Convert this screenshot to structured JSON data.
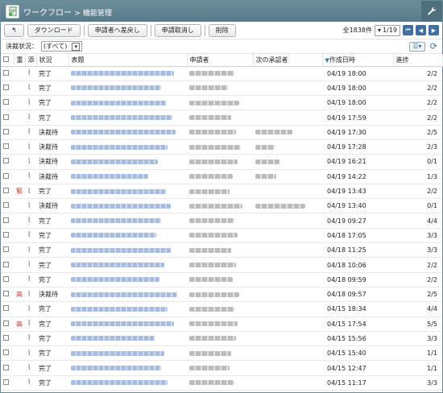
{
  "window": {
    "title": "ワークフロー",
    "separator": ">",
    "subtitle": "機能管理"
  },
  "toolbar": {
    "back_icon": "back-arrow-icon",
    "download_label": "ダウンロード",
    "return_label": "申請者へ差戻し",
    "cancel_label": "申請取消し",
    "delete_label": "削除",
    "total_label": "全1838件",
    "page_value": "1/19",
    "page_select_chevron": "▾"
  },
  "filter": {
    "label": "決裁状況：",
    "value": "(すべて)"
  },
  "table": {
    "headers": {
      "importance": "重",
      "attach": "添",
      "status": "状況",
      "subject": "表題",
      "applicant": "申請者",
      "next_approver": "次の承認者",
      "created": "作成日時",
      "progress": "進捗"
    },
    "rows": [
      {
        "priority": "",
        "status": "完了",
        "created": "04/19 18:00",
        "progress": "2/2",
        "has_next": false
      },
      {
        "priority": "",
        "status": "完了",
        "created": "04/19 18:00",
        "progress": "2/2",
        "has_next": false
      },
      {
        "priority": "",
        "status": "完了",
        "created": "04/19 18:00",
        "progress": "2/2",
        "has_next": false
      },
      {
        "priority": "",
        "status": "完了",
        "created": "04/19 17:59",
        "progress": "2/2",
        "has_next": false
      },
      {
        "priority": "",
        "status": "決裁待",
        "created": "04/19 17:30",
        "progress": "2/5",
        "has_next": true
      },
      {
        "priority": "",
        "status": "決裁待",
        "created": "04/19 17:28",
        "progress": "2/3",
        "has_next": true
      },
      {
        "priority": "",
        "status": "決裁待",
        "created": "04/19 16:21",
        "progress": "0/1",
        "has_next": true
      },
      {
        "priority": "",
        "status": "決裁待",
        "created": "04/19 14:22",
        "progress": "1/3",
        "has_next": true
      },
      {
        "priority": "緊",
        "status": "完了",
        "created": "04/19 13:43",
        "progress": "2/2",
        "has_next": false
      },
      {
        "priority": "",
        "status": "決裁待",
        "created": "04/19 13:40",
        "progress": "0/1",
        "has_next": true
      },
      {
        "priority": "",
        "status": "完了",
        "created": "04/19 09:27",
        "progress": "4/4",
        "has_next": false
      },
      {
        "priority": "",
        "status": "完了",
        "created": "04/18 17:05",
        "progress": "3/3",
        "has_next": false
      },
      {
        "priority": "",
        "status": "完了",
        "created": "04/18 11:25",
        "progress": "3/3",
        "has_next": false
      },
      {
        "priority": "",
        "status": "完了",
        "created": "04/18 10:06",
        "progress": "2/2",
        "has_next": false
      },
      {
        "priority": "",
        "status": "完了",
        "created": "04/18 09:59",
        "progress": "2/2",
        "has_next": false
      },
      {
        "priority": "高",
        "status": "決裁待",
        "created": "04/18 09:57",
        "progress": "2/5",
        "has_next": true
      },
      {
        "priority": "",
        "status": "完了",
        "created": "04/15 18:34",
        "progress": "4/4",
        "has_next": false
      },
      {
        "priority": "高",
        "status": "完了",
        "created": "04/15 17:54",
        "progress": "5/5",
        "has_next": false
      },
      {
        "priority": "",
        "status": "完了",
        "created": "04/15 15:56",
        "progress": "3/3",
        "has_next": false
      },
      {
        "priority": "",
        "status": "完了",
        "created": "04/15 15:40",
        "progress": "1/1",
        "has_next": false
      },
      {
        "priority": "",
        "status": "完了",
        "created": "04/15 12:47",
        "progress": "1/1",
        "has_next": false
      },
      {
        "priority": "",
        "status": "完了",
        "created": "04/15 11:17",
        "progress": "3/3",
        "has_next": false
      }
    ]
  },
  "colors": {
    "titlebar": "#587a89",
    "link_blur": "#9bb4da",
    "priority": "#c0392b",
    "nav_button": "#3f6f9f"
  }
}
